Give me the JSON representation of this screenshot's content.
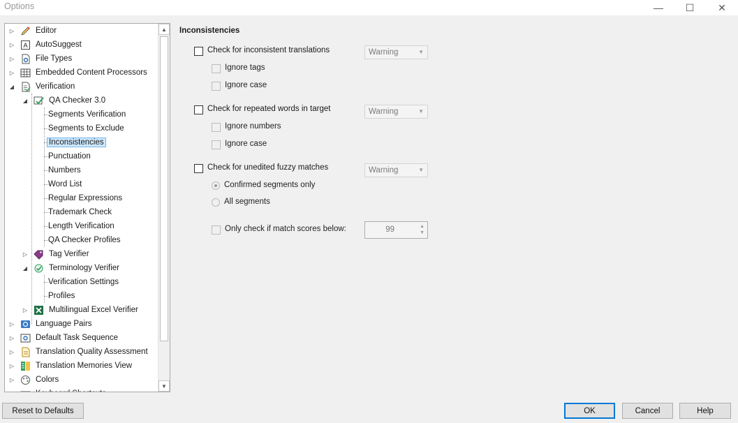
{
  "window": {
    "title": "Options"
  },
  "tree": {
    "nodes": [
      {
        "label": "Editor",
        "icon": "pencil-icon",
        "expander": "collapsed"
      },
      {
        "label": "AutoSuggest",
        "icon": "autosuggest-icon",
        "expander": "collapsed"
      },
      {
        "label": "File Types",
        "icon": "file-gear-icon",
        "expander": "collapsed"
      },
      {
        "label": "Embedded Content Processors",
        "icon": "grid-icon",
        "expander": "collapsed"
      },
      {
        "label": "Verification",
        "icon": "verification-doc-icon",
        "expander": "expanded"
      },
      {
        "label": "QA Checker 3.0",
        "icon": "qa-checker-icon",
        "expander": "expanded"
      },
      {
        "label": "Segments Verification"
      },
      {
        "label": "Segments to Exclude"
      },
      {
        "label": "Inconsistencies",
        "selected": true
      },
      {
        "label": "Punctuation"
      },
      {
        "label": "Numbers"
      },
      {
        "label": "Word List"
      },
      {
        "label": "Regular Expressions"
      },
      {
        "label": "Trademark Check"
      },
      {
        "label": "Length Verification"
      },
      {
        "label": "QA Checker Profiles"
      },
      {
        "label": "Tag Verifier",
        "icon": "tag-verifier-icon",
        "expander": "collapsed"
      },
      {
        "label": "Terminology Verifier",
        "icon": "terminology-check-icon",
        "expander": "expanded"
      },
      {
        "label": "Verification Settings"
      },
      {
        "label": "Profiles"
      },
      {
        "label": "Multilingual Excel Verifier",
        "icon": "excel-icon",
        "expander": "collapsed"
      },
      {
        "label": "Language Pairs",
        "icon": "language-pairs-icon",
        "expander": "collapsed"
      },
      {
        "label": "Default Task Sequence",
        "icon": "task-sequence-icon",
        "expander": "collapsed"
      },
      {
        "label": "Translation Quality Assessment",
        "icon": "tqa-icon",
        "expander": "collapsed"
      },
      {
        "label": "Translation Memories View",
        "icon": "tm-view-icon",
        "expander": "collapsed"
      },
      {
        "label": "Colors",
        "icon": "palette-icon",
        "expander": "collapsed"
      },
      {
        "label": "Keyboard Shortcuts",
        "icon": "keyboard-icon",
        "expander": "collapsed"
      }
    ]
  },
  "panel": {
    "title": "Inconsistencies",
    "inconsistent": {
      "label": "Check for inconsistent translations",
      "severity": "Warning",
      "ignore_tags": "Ignore tags",
      "ignore_case": "Ignore case"
    },
    "repeated": {
      "label": "Check for repeated words in target",
      "severity": "Warning",
      "ignore_numbers": "Ignore numbers",
      "ignore_case": "Ignore case"
    },
    "fuzzy": {
      "label": "Check for unedited fuzzy matches",
      "severity": "Warning",
      "confirmed_only": "Confirmed segments only",
      "all_segments": "All segments",
      "match_score_label": "Only check if match scores below:",
      "match_score_value": "99"
    }
  },
  "buttons": {
    "reset": "Reset to Defaults",
    "ok": "OK",
    "cancel": "Cancel",
    "help": "Help"
  }
}
